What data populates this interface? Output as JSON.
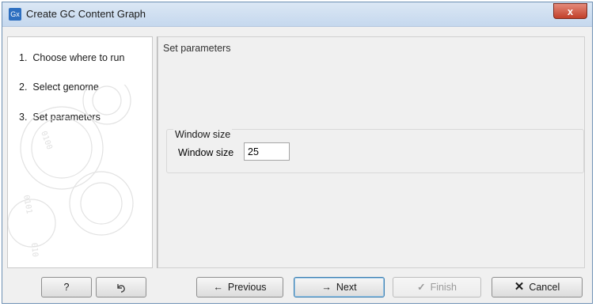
{
  "window": {
    "title": "Create GC Content Graph",
    "app_icon": "Gx",
    "close_symbol": "x"
  },
  "steps": [
    {
      "number": "1.",
      "label": "Choose where to run"
    },
    {
      "number": "2.",
      "label": "Select genome"
    },
    {
      "number": "3.",
      "label": "Set parameters"
    }
  ],
  "panel": {
    "title": "Set parameters",
    "group_title": "Window size",
    "field_label": "Window size",
    "field_value": "25"
  },
  "buttons": {
    "help_label": "?",
    "reset_icon": "reset-icon",
    "previous_label": "Previous",
    "next_label": "Next",
    "finish_label": "Finish",
    "cancel_label": "Cancel"
  },
  "colors": {
    "title_bar": "#c5d8ee",
    "close": "#c2402a",
    "default_button_border": "#3c7fb1"
  }
}
